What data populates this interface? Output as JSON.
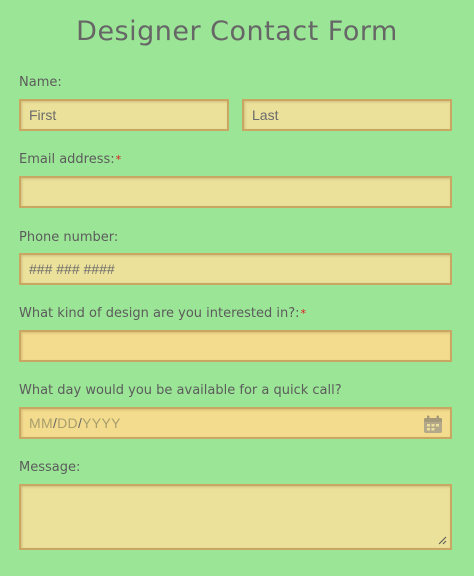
{
  "form": {
    "title": "Designer Contact Form",
    "name_label": "Name:",
    "first_placeholder": "First",
    "last_placeholder": "Last",
    "email_label": "Email address:",
    "phone_label": "Phone number:",
    "phone_placeholder": "### ### ####",
    "design_label": "What kind of design are you interested in?:",
    "call_label": "What day would you be available for a quick call?",
    "date_mm": "MM",
    "date_dd": "DD",
    "date_yyyy": "YYYY",
    "date_sep": "/",
    "message_label": "Message:",
    "required_marker": "*"
  },
  "colors": {
    "background": "#9be596",
    "field": "#ebe19a",
    "field_highlight": "#f4dc8e",
    "field_border": "#c9a763",
    "required": "#e0141e"
  }
}
